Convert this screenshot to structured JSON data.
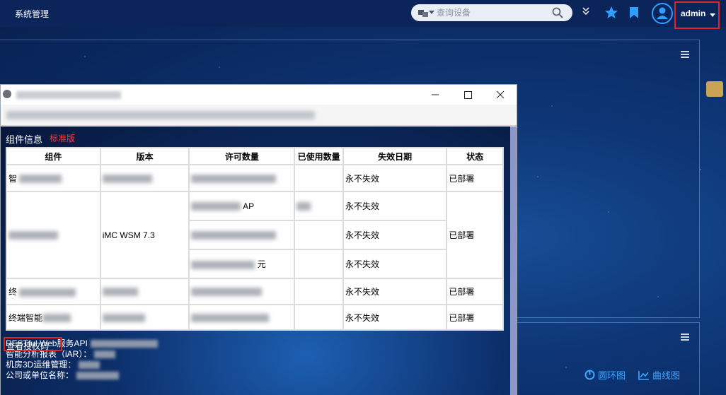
{
  "header": {
    "app_title": "系统管理",
    "search_placeholder": "查询设备",
    "user_name": "admin"
  },
  "dashboard": {
    "chart_links": [
      "圆环图",
      "曲线图"
    ]
  },
  "dialog": {
    "section_title": "组件信息",
    "edition": "标准版",
    "table": {
      "columns": [
        "组件",
        "版本",
        "许可数量",
        "已使用数量",
        "失效日期",
        "状态"
      ],
      "rows": [
        {
          "component": "智",
          "version": "",
          "license": "",
          "used": "",
          "expire": "永不失效",
          "status": "已部署"
        },
        {
          "component": "",
          "version": "iMC WSM 7.3",
          "license": "AP",
          "used": "",
          "expire": "永不失效",
          "status": "已部署"
        },
        {
          "component": "",
          "version": "",
          "license": "",
          "used": "",
          "expire": "永不失效",
          "status": ""
        },
        {
          "component": "",
          "version": "",
          "license": "元",
          "used": "",
          "expire": "永不失效",
          "status": ""
        },
        {
          "component": "终",
          "version": "",
          "license": "",
          "used": "",
          "expire": "永不失效",
          "status": "已部署"
        },
        {
          "component": "终端智能",
          "version": "",
          "license": "",
          "used": "",
          "expire": "永不失效",
          "status": "已部署"
        }
      ]
    },
    "info": [
      "RESTful Web服务API",
      "智能分析报表（iAR）：",
      "机房3D运维管理：",
      "公司或单位名称："
    ],
    "license_link": "查看授权码"
  },
  "colors": {
    "accent": "#2fa0ff",
    "highlight_border": "#e02424",
    "edition_red": "#ff3b3b"
  }
}
